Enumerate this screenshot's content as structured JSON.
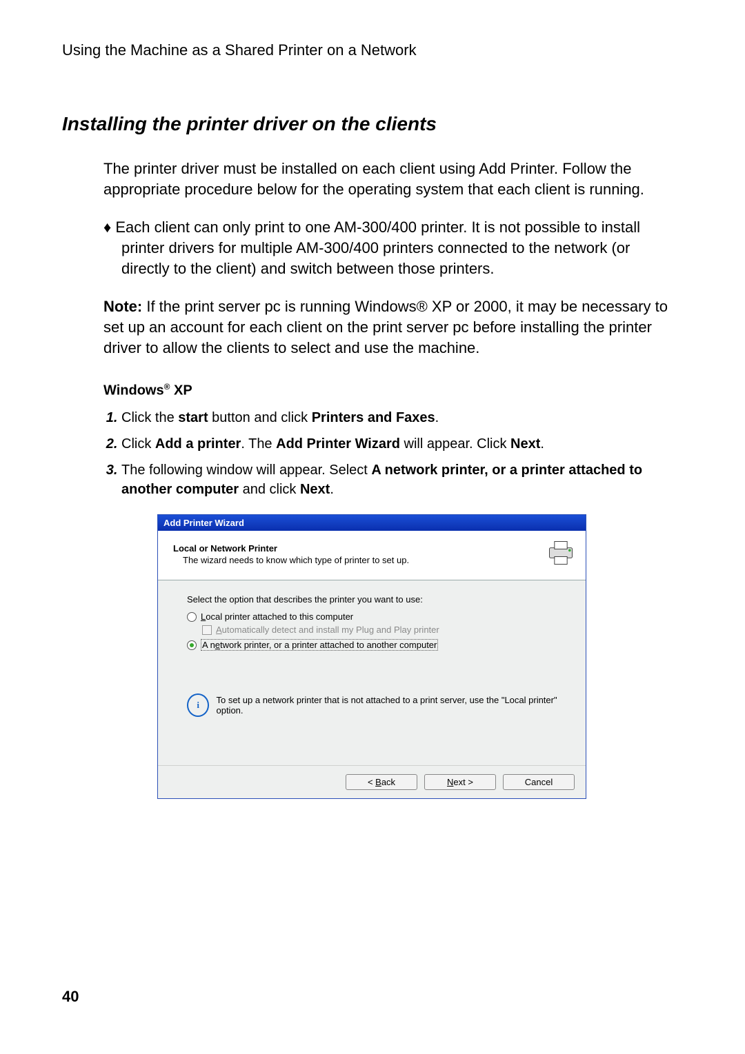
{
  "running_head": "Using the Machine as a Shared Printer on a Network",
  "section_title": "Installing the printer driver on the clients",
  "intro": "The printer driver must be installed on each client using Add Printer. Follow the appropriate procedure below for the operating system that each client is running.",
  "bullet_marker": "♦",
  "bullet": "Each client can only print to one AM-300/400 printer. It is not possible to install printer drivers for multiple AM-300/400 printers connected to the network (or directly to the client) and switch between those printers.",
  "note_label": "Note:",
  "note_body": " If the print server pc is running Windows® XP or 2000, it may be necessary to set up an account for each client on the print server pc before installing the printer driver to allow the clients to select and use the machine.",
  "os_heading_prefix": "Windows",
  "os_heading_suffix": " XP",
  "registered": "®",
  "steps": [
    {
      "pre": "Click the ",
      "b1": "start",
      "mid": " button and click ",
      "b2": "Printers and Faxes",
      "post": "."
    },
    {
      "pre": "Click ",
      "b1": "Add a printer",
      "mid": ". The ",
      "b2": "Add Printer Wizard",
      "post": " will appear. Click ",
      "b3": "Next",
      "tail": "."
    },
    {
      "pre": "The following window will appear. Select ",
      "b1": "A network printer, or a printer attached to another computer",
      "mid": " and click ",
      "b2": "Next",
      "post": "."
    }
  ],
  "wizard": {
    "title": "Add Printer Wizard",
    "head1": "Local or Network Printer",
    "head2": "The wizard needs to know which type of printer to set up.",
    "prompt": "Select the option that describes the printer you want to use:",
    "opt_local_ak": "L",
    "opt_local_rest": "ocal printer attached to this computer",
    "auto_ak": "A",
    "auto_rest": "utomatically detect and install my Plug and Play printer",
    "opt_net_pre": "A n",
    "opt_net_ak": "e",
    "opt_net_rest": "twork printer, or a printer attached to another computer",
    "info": "To set up a network printer that is not attached to a print server, use the \"Local printer\" option.",
    "back_ak": "B",
    "back_rest": "ack",
    "next_ak": "N",
    "next_rest": "ext >",
    "cancel": "Cancel"
  },
  "page_number": "40"
}
